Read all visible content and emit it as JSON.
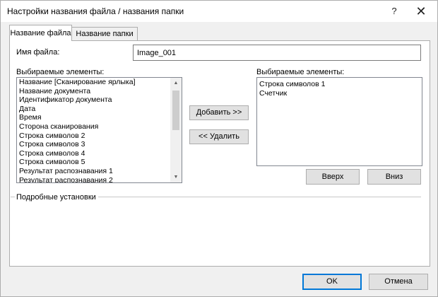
{
  "window": {
    "title": "Настройки названия файла / названия папки",
    "help_glyph": "?",
    "close_glyph": "✕"
  },
  "tabs": [
    {
      "label": "Название файла",
      "active": true
    },
    {
      "label": "Название папки",
      "active": false
    }
  ],
  "filename": {
    "label": "Имя файла:",
    "value": "Image_001"
  },
  "available": {
    "label": "Выбираемые элементы:",
    "items": [
      "Название [Сканирование ярлыка]",
      "Название документа",
      "Идентификатор документа",
      "Дата",
      "Время",
      "Сторона сканирования",
      "Строка символов 2",
      "Строка символов 3",
      "Строка символов 4",
      "Строка символов 5",
      "Результат распознавания 1",
      "Результат распознавания 2"
    ]
  },
  "selected": {
    "label": "Выбираемые элементы:",
    "items": [
      "Строка символов 1",
      "Счетчик"
    ]
  },
  "buttons": {
    "add": "Добавить >>",
    "remove": "<< Удалить",
    "up": "Вверх",
    "down": "Вниз",
    "ok": "OK",
    "cancel": "Отмена"
  },
  "advanced": {
    "label": "Подробные установки"
  }
}
